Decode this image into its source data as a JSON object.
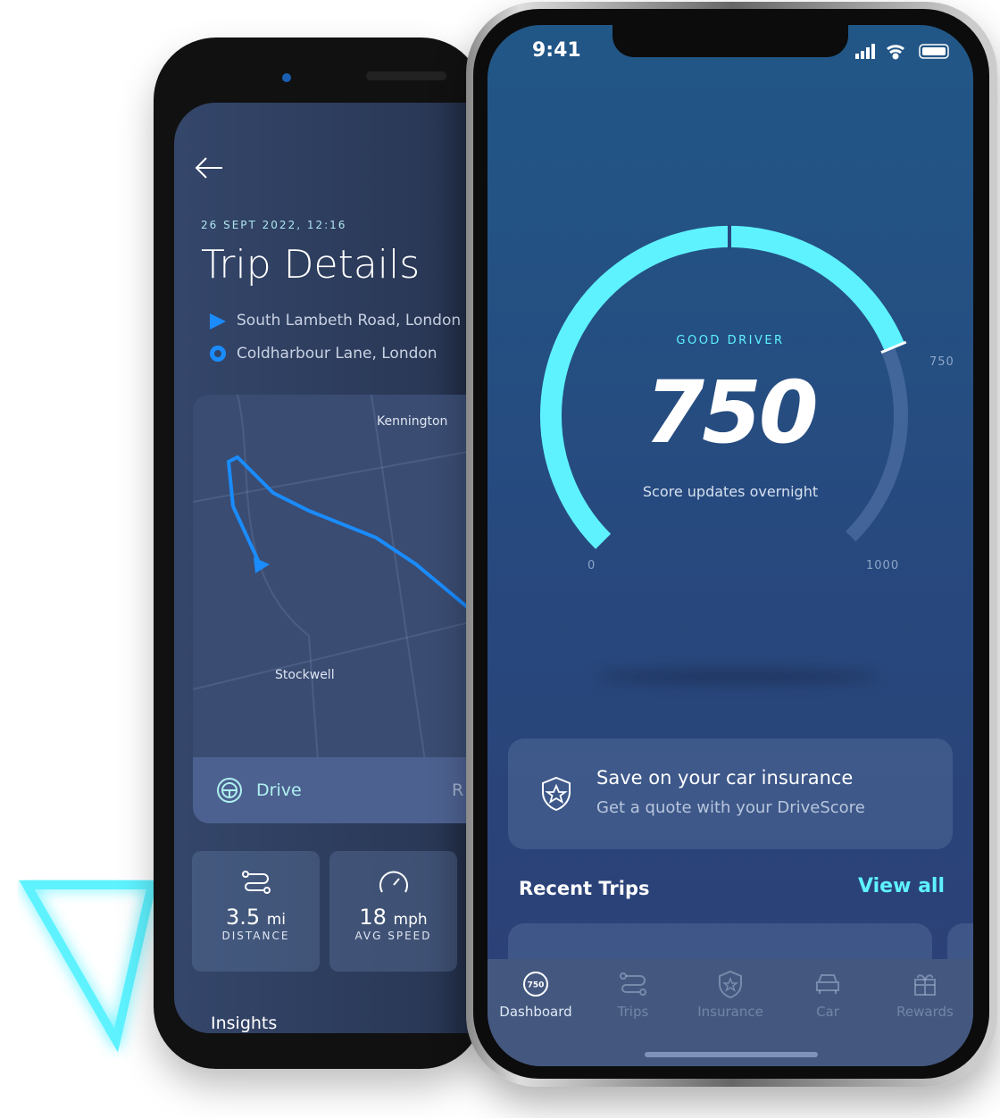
{
  "back_phone": {
    "date": "26 SEPT 2022, 12:16",
    "title": "Trip Details",
    "start": "South Lambeth Road, London",
    "end": "Coldharbour Lane, London",
    "map_labels": [
      "Kennington",
      "Stockwell"
    ],
    "mode_tabs": [
      "Drive",
      "R"
    ],
    "stats": [
      {
        "value": "3.5",
        "unit": "mi",
        "label": "DISTANCE"
      },
      {
        "value": "18",
        "unit": "mph",
        "label": "AVG SPEED"
      }
    ],
    "section": "Insights"
  },
  "front_phone": {
    "time": "9:41",
    "gauge": {
      "status": "GOOD DRIVER",
      "score": "750",
      "subtitle": "Score updates overnight",
      "min_label": "0",
      "max_label": "1000",
      "marker_label": "750",
      "value": 750,
      "min": 0,
      "max": 1000,
      "accent": "#5ef2ff"
    },
    "promo": {
      "title": "Save on your car insurance",
      "subtitle": "Get a quote with your DriveScore"
    },
    "recent": {
      "title": "Recent Trips",
      "link": "View all"
    },
    "nav": [
      {
        "label": "Dashboard",
        "icon": "score-badge-icon",
        "badge": "750"
      },
      {
        "label": "Trips",
        "icon": "route-icon"
      },
      {
        "label": "Insurance",
        "icon": "shield-star-icon"
      },
      {
        "label": "Car",
        "icon": "car-icon"
      },
      {
        "label": "Rewards",
        "icon": "gift-icon"
      }
    ]
  }
}
